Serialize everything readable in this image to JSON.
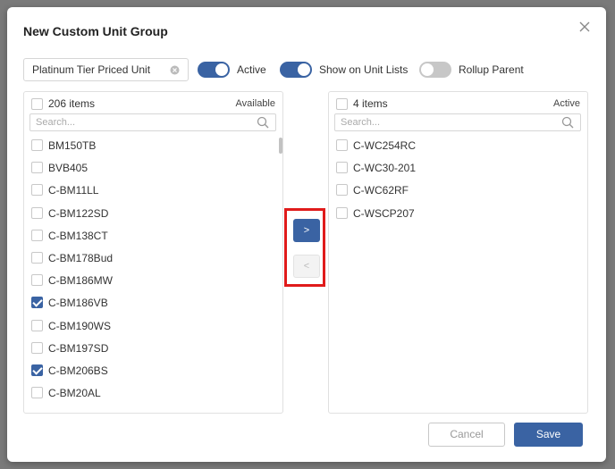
{
  "dialog": {
    "title": "New Custom Unit Group"
  },
  "form": {
    "name_value": "Platinum Tier Priced Units",
    "toggles": [
      {
        "label": "Active",
        "state": "on"
      },
      {
        "label": "Show on Unit Lists",
        "state": "on"
      },
      {
        "label": "Rollup Parent",
        "state": "off"
      }
    ]
  },
  "available": {
    "count": "206 items",
    "tag": "Available",
    "search_placeholder": "Search...",
    "items": [
      {
        "label": "BM150TB",
        "checked": false
      },
      {
        "label": "BVB405",
        "checked": false
      },
      {
        "label": "C-BM11LL",
        "checked": false
      },
      {
        "label": "C-BM122SD",
        "checked": false
      },
      {
        "label": "C-BM138CT",
        "checked": false
      },
      {
        "label": "C-BM178Bud",
        "checked": false
      },
      {
        "label": "C-BM186MW",
        "checked": false
      },
      {
        "label": "C-BM186VB",
        "checked": true
      },
      {
        "label": "C-BM190WS",
        "checked": false
      },
      {
        "label": "C-BM197SD",
        "checked": false
      },
      {
        "label": "C-BM206BS",
        "checked": true
      },
      {
        "label": "C-BM20AL",
        "checked": false
      }
    ]
  },
  "active": {
    "count": "4 items",
    "tag": "Active",
    "search_placeholder": "Search...",
    "items": [
      {
        "label": "C-WC254RC",
        "checked": false
      },
      {
        "label": "C-WC30-201",
        "checked": false
      },
      {
        "label": "C-WC62RF",
        "checked": false
      },
      {
        "label": "C-WSCP207",
        "checked": false
      }
    ]
  },
  "transfer": {
    "move_right": ">",
    "move_left": "<"
  },
  "footer": {
    "cancel": "Cancel",
    "save": "Save"
  },
  "colors": {
    "accent": "#3a63a3",
    "highlight_border": "#e01b1b"
  }
}
